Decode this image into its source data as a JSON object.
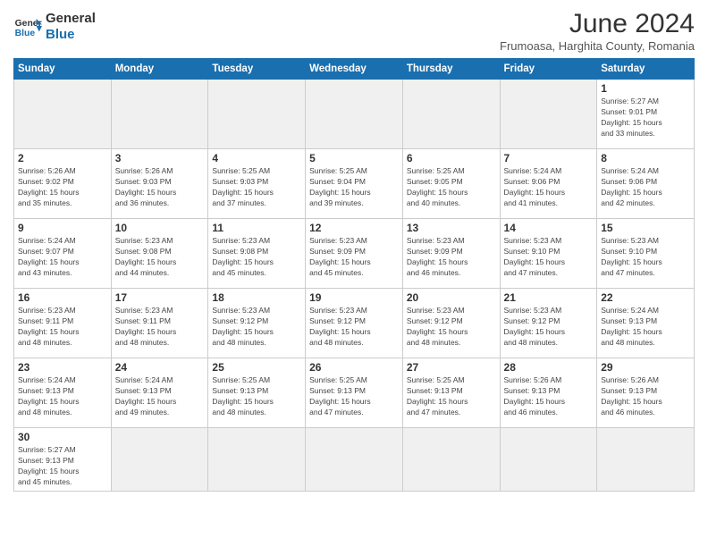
{
  "header": {
    "logo_general": "General",
    "logo_blue": "Blue",
    "month_year": "June 2024",
    "location": "Frumoasa, Harghita County, Romania"
  },
  "days_of_week": [
    "Sunday",
    "Monday",
    "Tuesday",
    "Wednesday",
    "Thursday",
    "Friday",
    "Saturday"
  ],
  "weeks": [
    [
      {
        "day": "",
        "info": "",
        "empty": true
      },
      {
        "day": "",
        "info": "",
        "empty": true
      },
      {
        "day": "",
        "info": "",
        "empty": true
      },
      {
        "day": "",
        "info": "",
        "empty": true
      },
      {
        "day": "",
        "info": "",
        "empty": true
      },
      {
        "day": "",
        "info": "",
        "empty": true
      },
      {
        "day": "1",
        "info": "Sunrise: 5:27 AM\nSunset: 9:01 PM\nDaylight: 15 hours\nand 33 minutes."
      }
    ],
    [
      {
        "day": "2",
        "info": "Sunrise: 5:26 AM\nSunset: 9:02 PM\nDaylight: 15 hours\nand 35 minutes."
      },
      {
        "day": "3",
        "info": "Sunrise: 5:26 AM\nSunset: 9:03 PM\nDaylight: 15 hours\nand 36 minutes."
      },
      {
        "day": "4",
        "info": "Sunrise: 5:25 AM\nSunset: 9:03 PM\nDaylight: 15 hours\nand 37 minutes."
      },
      {
        "day": "5",
        "info": "Sunrise: 5:25 AM\nSunset: 9:04 PM\nDaylight: 15 hours\nand 39 minutes."
      },
      {
        "day": "6",
        "info": "Sunrise: 5:25 AM\nSunset: 9:05 PM\nDaylight: 15 hours\nand 40 minutes."
      },
      {
        "day": "7",
        "info": "Sunrise: 5:24 AM\nSunset: 9:06 PM\nDaylight: 15 hours\nand 41 minutes."
      },
      {
        "day": "8",
        "info": "Sunrise: 5:24 AM\nSunset: 9:06 PM\nDaylight: 15 hours\nand 42 minutes."
      }
    ],
    [
      {
        "day": "9",
        "info": "Sunrise: 5:24 AM\nSunset: 9:07 PM\nDaylight: 15 hours\nand 43 minutes."
      },
      {
        "day": "10",
        "info": "Sunrise: 5:23 AM\nSunset: 9:08 PM\nDaylight: 15 hours\nand 44 minutes."
      },
      {
        "day": "11",
        "info": "Sunrise: 5:23 AM\nSunset: 9:08 PM\nDaylight: 15 hours\nand 45 minutes."
      },
      {
        "day": "12",
        "info": "Sunrise: 5:23 AM\nSunset: 9:09 PM\nDaylight: 15 hours\nand 45 minutes."
      },
      {
        "day": "13",
        "info": "Sunrise: 5:23 AM\nSunset: 9:09 PM\nDaylight: 15 hours\nand 46 minutes."
      },
      {
        "day": "14",
        "info": "Sunrise: 5:23 AM\nSunset: 9:10 PM\nDaylight: 15 hours\nand 47 minutes."
      },
      {
        "day": "15",
        "info": "Sunrise: 5:23 AM\nSunset: 9:10 PM\nDaylight: 15 hours\nand 47 minutes."
      }
    ],
    [
      {
        "day": "16",
        "info": "Sunrise: 5:23 AM\nSunset: 9:11 PM\nDaylight: 15 hours\nand 48 minutes."
      },
      {
        "day": "17",
        "info": "Sunrise: 5:23 AM\nSunset: 9:11 PM\nDaylight: 15 hours\nand 48 minutes."
      },
      {
        "day": "18",
        "info": "Sunrise: 5:23 AM\nSunset: 9:12 PM\nDaylight: 15 hours\nand 48 minutes."
      },
      {
        "day": "19",
        "info": "Sunrise: 5:23 AM\nSunset: 9:12 PM\nDaylight: 15 hours\nand 48 minutes."
      },
      {
        "day": "20",
        "info": "Sunrise: 5:23 AM\nSunset: 9:12 PM\nDaylight: 15 hours\nand 48 minutes."
      },
      {
        "day": "21",
        "info": "Sunrise: 5:23 AM\nSunset: 9:12 PM\nDaylight: 15 hours\nand 48 minutes."
      },
      {
        "day": "22",
        "info": "Sunrise: 5:24 AM\nSunset: 9:13 PM\nDaylight: 15 hours\nand 48 minutes."
      }
    ],
    [
      {
        "day": "23",
        "info": "Sunrise: 5:24 AM\nSunset: 9:13 PM\nDaylight: 15 hours\nand 48 minutes."
      },
      {
        "day": "24",
        "info": "Sunrise: 5:24 AM\nSunset: 9:13 PM\nDaylight: 15 hours\nand 49 minutes."
      },
      {
        "day": "25",
        "info": "Sunrise: 5:25 AM\nSunset: 9:13 PM\nDaylight: 15 hours\nand 48 minutes."
      },
      {
        "day": "26",
        "info": "Sunrise: 5:25 AM\nSunset: 9:13 PM\nDaylight: 15 hours\nand 47 minutes."
      },
      {
        "day": "27",
        "info": "Sunrise: 5:25 AM\nSunset: 9:13 PM\nDaylight: 15 hours\nand 47 minutes."
      },
      {
        "day": "28",
        "info": "Sunrise: 5:26 AM\nSunset: 9:13 PM\nDaylight: 15 hours\nand 46 minutes."
      },
      {
        "day": "29",
        "info": "Sunrise: 5:26 AM\nSunset: 9:13 PM\nDaylight: 15 hours\nand 46 minutes."
      }
    ],
    [
      {
        "day": "30",
        "info": "Sunrise: 5:27 AM\nSunset: 9:13 PM\nDaylight: 15 hours\nand 45 minutes."
      },
      {
        "day": "",
        "info": "",
        "empty": true
      },
      {
        "day": "",
        "info": "",
        "empty": true
      },
      {
        "day": "",
        "info": "",
        "empty": true
      },
      {
        "day": "",
        "info": "",
        "empty": true
      },
      {
        "day": "",
        "info": "",
        "empty": true
      },
      {
        "day": "",
        "info": "",
        "empty": true
      }
    ]
  ]
}
